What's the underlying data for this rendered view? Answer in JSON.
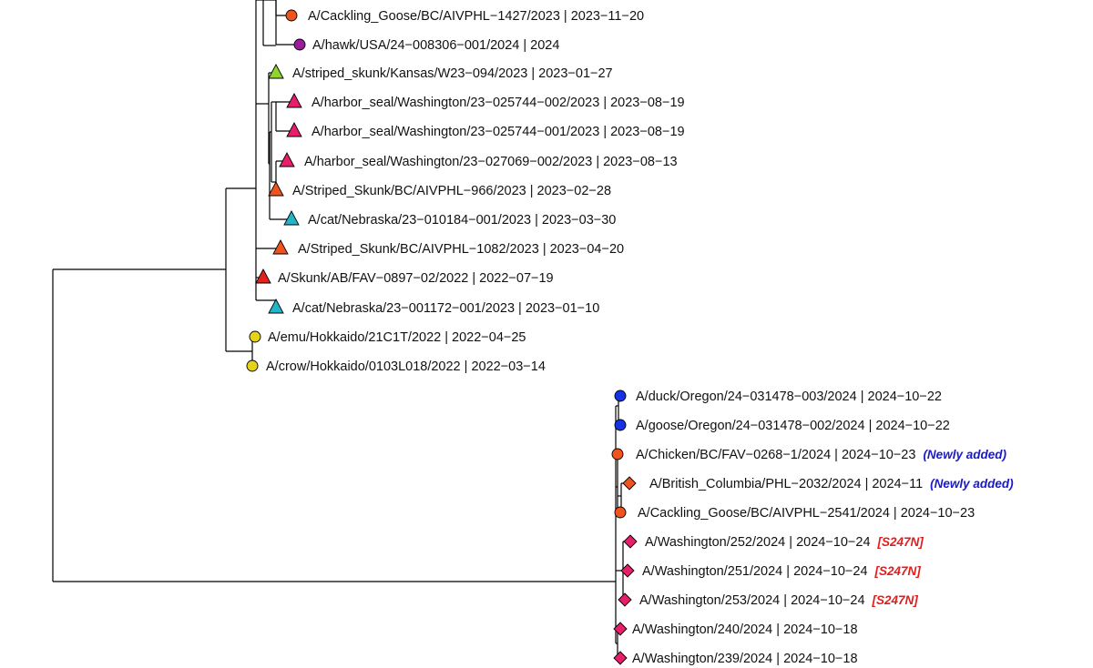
{
  "tips": [
    {
      "label": "A/Cackling_Goose/BC/AIVPHL−1427/2023 | 2023−11−20",
      "shape": "circle",
      "color": "#F0541E",
      "tag": null
    },
    {
      "label": "A/hawk/USA/24−008306−001/2024 | 2024",
      "shape": "circle",
      "color": "#9A1C9C",
      "tag": null
    },
    {
      "label": "A/striped_skunk/Kansas/W23−094/2023 | 2023−01−27",
      "shape": "triangle",
      "color": "#8FD62B",
      "tag": null
    },
    {
      "label": "A/harbor_seal/Washington/23−025744−002/2023 | 2023−08−19",
      "shape": "triangle",
      "color": "#E81E6A",
      "tag": null
    },
    {
      "label": "A/harbor_seal/Washington/23−025744−001/2023 | 2023−08−19",
      "shape": "triangle",
      "color": "#E81E6A",
      "tag": null
    },
    {
      "label": "A/harbor_seal/Washington/23−027069−002/2023 | 2023−08−13",
      "shape": "triangle",
      "color": "#E81E6A",
      "tag": null
    },
    {
      "label": "A/Striped_Skunk/BC/AIVPHL−966/2023 | 2023−02−28",
      "shape": "triangle",
      "color": "#F0541E",
      "tag": null
    },
    {
      "label": "A/cat/Nebraska/23−010184−001/2023 | 2023−03−30",
      "shape": "triangle",
      "color": "#22B5C8",
      "tag": null
    },
    {
      "label": "A/Striped_Skunk/BC/AIVPHL−1082/2023 | 2023−04−20",
      "shape": "triangle",
      "color": "#F0541E",
      "tag": null
    },
    {
      "label": "A/Skunk/AB/FAV−0897−02/2022 | 2022−07−19",
      "shape": "triangle",
      "color": "#E3231B",
      "tag": null
    },
    {
      "label": "A/cat/Nebraska/23−001172−001/2023 | 2023−01−10",
      "shape": "triangle",
      "color": "#22B5C8",
      "tag": null
    },
    {
      "label": "A/emu/Hokkaido/21C1T/2022 | 2022−04−25",
      "shape": "circle",
      "color": "#E5D21A",
      "tag": null
    },
    {
      "label": "A/crow/Hokkaido/0103L018/2022 | 2022−03−14",
      "shape": "circle",
      "color": "#E5D21A",
      "tag": null
    },
    {
      "label": "A/duck/Oregon/24−031478−003/2024 | 2024−10−22",
      "shape": "circle",
      "color": "#1533E6",
      "tag": null
    },
    {
      "label": "A/goose/Oregon/24−031478−002/2024 | 2024−10−22",
      "shape": "circle",
      "color": "#1533E6",
      "tag": null
    },
    {
      "label": "A/Chicken/BC/FAV−0268−1/2024 | 2024−10−23",
      "shape": "circle",
      "color": "#F0541E",
      "tag": "(Newly added)"
    },
    {
      "label": "A/British_Columbia/PHL−2032/2024 | 2024−11",
      "shape": "diamond",
      "color": "#F0541E",
      "tag": "(Newly added)"
    },
    {
      "label": "A/Cackling_Goose/BC/AIVPHL−2541/2024 | 2024−10−23",
      "shape": "circle",
      "color": "#F0541E",
      "tag": null
    },
    {
      "label": "A/Washington/252/2024 | 2024−10−24",
      "shape": "diamond",
      "color": "#E81E6A",
      "tag": "[S247N]"
    },
    {
      "label": "A/Washington/251/2024 | 2024−10−24",
      "shape": "diamond",
      "color": "#E81E6A",
      "tag": "[S247N]"
    },
    {
      "label": "A/Washington/253/2024 | 2024−10−24",
      "shape": "diamond",
      "color": "#E81E6A",
      "tag": "[S247N]"
    },
    {
      "label": "A/Washington/240/2024 | 2024−10−18",
      "shape": "diamond",
      "color": "#E81E6A",
      "tag": null
    },
    {
      "label": "A/Washington/239/2024 | 2024−10−18",
      "shape": "diamond",
      "color": "#E81E6A",
      "tag": null
    }
  ],
  "tag_colors": {
    "(Newly added)": "#1A1ACC",
    "[S247N]": "#E31B1B"
  }
}
